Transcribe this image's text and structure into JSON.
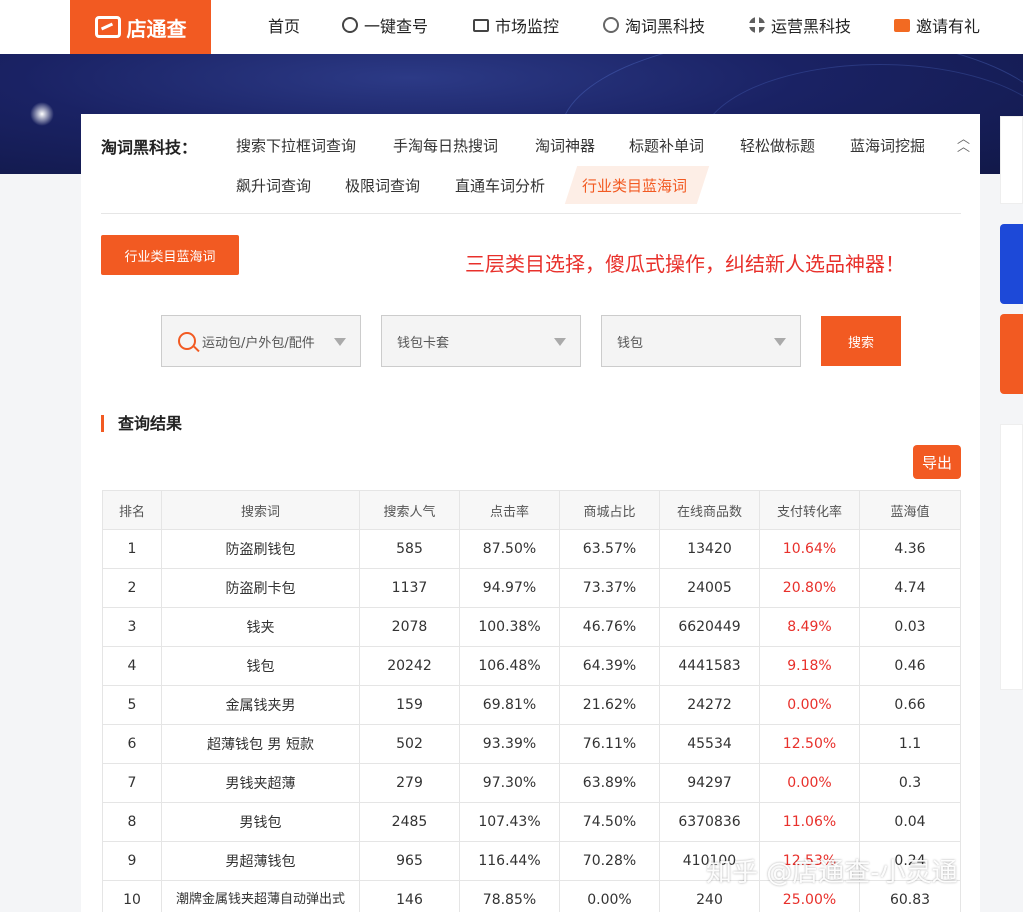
{
  "brand": {
    "name": "店通查",
    "color": "#f25a22"
  },
  "nav": [
    {
      "label": "首页",
      "icon": ""
    },
    {
      "label": "一键查号",
      "icon": "eye-icon"
    },
    {
      "label": "市场监控",
      "icon": "monitor-icon"
    },
    {
      "label": "淘词黑科技",
      "icon": "keyword-icon"
    },
    {
      "label": "运营黑科技",
      "icon": "grid-icon"
    },
    {
      "label": "邀请有礼",
      "icon": "gift-icon"
    }
  ],
  "subnav": {
    "title": "淘词黑科技：",
    "items": [
      "搜索下拉框词查询",
      "手淘每日热搜词",
      "淘词神器",
      "标题补单词",
      "轻松做标题",
      "蓝海词挖掘",
      "飙升词查询",
      "极限词查询",
      "直通车词分析",
      "行业类目蓝海词"
    ],
    "active": "行业类目蓝海词"
  },
  "tool": {
    "tag_label": "行业类目蓝海词",
    "slogan": "三层类目选择，傻瓜式操作，纠结新人选品神器！",
    "select1": "运动包/户外包/配件",
    "select2": "钱包卡套",
    "select3": "钱包",
    "search_label": "搜索"
  },
  "results": {
    "title": "查询结果",
    "export_label": "导出",
    "headers": [
      "排名",
      "搜索词",
      "搜索人气",
      "点击率",
      "商城占比",
      "在线商品数",
      "支付转化率",
      "蓝海值"
    ],
    "rows": [
      [
        "1",
        "防盗刷钱包",
        "585",
        "87.50%",
        "63.57%",
        "13420",
        "10.64%",
        "4.36"
      ],
      [
        "2",
        "防盗刷卡包",
        "1137",
        "94.97%",
        "73.37%",
        "24005",
        "20.80%",
        "4.74"
      ],
      [
        "3",
        "钱夹",
        "2078",
        "100.38%",
        "46.76%",
        "6620449",
        "8.49%",
        "0.03"
      ],
      [
        "4",
        "钱包",
        "20242",
        "106.48%",
        "64.39%",
        "4441583",
        "9.18%",
        "0.46"
      ],
      [
        "5",
        "金属钱夹男",
        "159",
        "69.81%",
        "21.62%",
        "24272",
        "0.00%",
        "0.66"
      ],
      [
        "6",
        "超薄钱包 男 短款",
        "502",
        "93.39%",
        "76.11%",
        "45534",
        "12.50%",
        "1.1"
      ],
      [
        "7",
        "男钱夹超薄",
        "279",
        "97.30%",
        "63.89%",
        "94297",
        "0.00%",
        "0.3"
      ],
      [
        "8",
        "男钱包",
        "2485",
        "107.43%",
        "74.50%",
        "6370836",
        "11.06%",
        "0.04"
      ],
      [
        "9",
        "男超薄钱包",
        "965",
        "116.44%",
        "70.28%",
        "410100",
        "12.53%",
        "0.24"
      ],
      [
        "10",
        "潮牌金属钱夹超薄自动弹出式",
        "146",
        "78.85%",
        "0.00%",
        "240",
        "25.00%",
        "60.83"
      ]
    ]
  },
  "watermark": "知乎 @店通查-小灵通",
  "colors": {
    "accent": "#f25a22",
    "red_text": "#e8302b",
    "banner": "#1a2264"
  }
}
